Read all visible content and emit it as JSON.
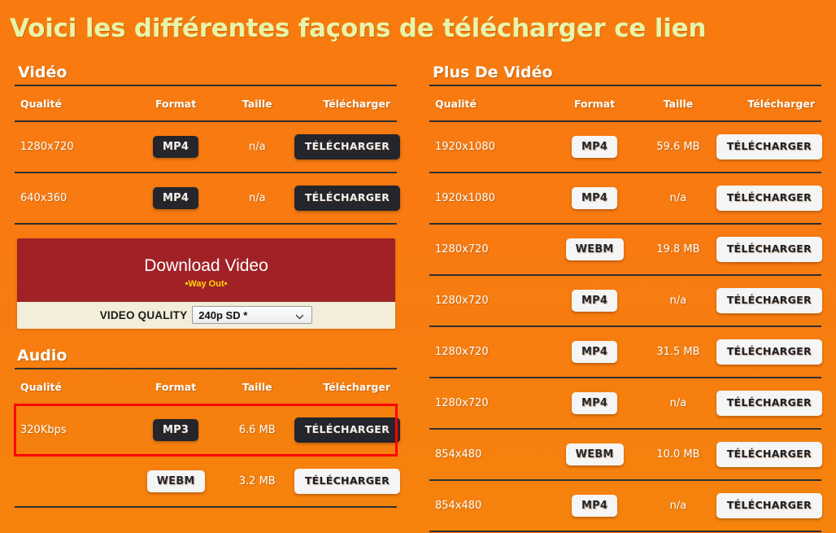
{
  "page": {
    "title": "Voici les différentes façons de télécharger ce lien",
    "background_color": "#f87a11",
    "title_color": "#e8f5a8"
  },
  "columns": {
    "headers": {
      "quality": "Qualité",
      "format": "Format",
      "size": "Taille",
      "download": "Télécharger"
    }
  },
  "video_section": {
    "heading": "Vidéo",
    "rows": [
      {
        "quality": "1280x720",
        "format": "MP4",
        "size": "n/a",
        "download": "TÉLÉCHARGER",
        "style": "dark"
      },
      {
        "quality": "640x360",
        "format": "MP4",
        "size": "n/a",
        "download": "TÉLÉCHARGER",
        "style": "dark"
      }
    ]
  },
  "ad": {
    "title": "Download Video",
    "subtitle": "•Way Out•",
    "quality_label": "VIDEO QUALITY",
    "selected_quality": "240p SD *",
    "background_color": "#a12226",
    "footer_color": "#f2eeda",
    "subtitle_color": "#ffd700"
  },
  "audio_section": {
    "heading": "Audio",
    "rows": [
      {
        "quality": "320Kbps",
        "format": "MP3",
        "size": "6.6 MB",
        "download": "TÉLÉCHARGER",
        "style": "dark",
        "highlighted": true
      },
      {
        "quality": "",
        "format": "WEBM",
        "size": "3.2 MB",
        "download": "TÉLÉCHARGER",
        "style": "light",
        "highlighted": false
      }
    ],
    "highlight_color": "#ff0000"
  },
  "more_video_section": {
    "heading": "Plus De Vidéo",
    "rows": [
      {
        "quality": "1920x1080",
        "format": "MP4",
        "size": "59.6 MB",
        "download": "TÉLÉCHARGER",
        "style": "light"
      },
      {
        "quality": "1920x1080",
        "format": "MP4",
        "size": "n/a",
        "download": "TÉLÉCHARGER",
        "style": "light"
      },
      {
        "quality": "1280x720",
        "format": "WEBM",
        "size": "19.8 MB",
        "download": "TÉLÉCHARGER",
        "style": "light"
      },
      {
        "quality": "1280x720",
        "format": "MP4",
        "size": "n/a",
        "download": "TÉLÉCHARGER",
        "style": "light"
      },
      {
        "quality": "1280x720",
        "format": "MP4",
        "size": "31.5 MB",
        "download": "TÉLÉCHARGER",
        "style": "light"
      },
      {
        "quality": "1280x720",
        "format": "MP4",
        "size": "n/a",
        "download": "TÉLÉCHARGER",
        "style": "light"
      },
      {
        "quality": "854x480",
        "format": "WEBM",
        "size": "10.0 MB",
        "download": "TÉLÉCHARGER",
        "style": "light"
      },
      {
        "quality": "854x480",
        "format": "MP4",
        "size": "n/a",
        "download": "TÉLÉCHARGER",
        "style": "light"
      }
    ]
  }
}
